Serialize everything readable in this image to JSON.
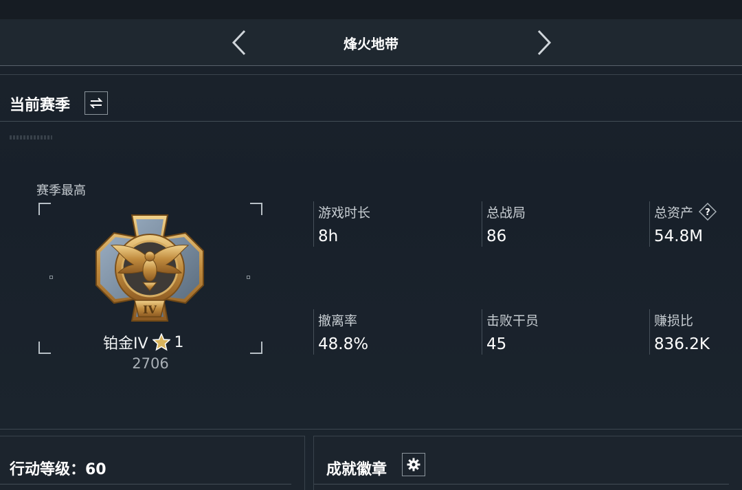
{
  "header": {
    "title": "烽火地带"
  },
  "season": {
    "title": "当前赛季",
    "rank_label": "赛季最高",
    "rank_name": "铂金IV",
    "rank_stars": "1",
    "rank_score": "2706",
    "medal_numeral": "IV"
  },
  "stats": [
    {
      "label": "游戏时长",
      "value": "8h"
    },
    {
      "label": "总战局",
      "value": "86"
    },
    {
      "label": "总资产",
      "value": "54.8M"
    },
    {
      "label": "撤离率",
      "value": "48.8%"
    },
    {
      "label": "击败干员",
      "value": "45"
    },
    {
      "label": "赚损比",
      "value": "836.2K"
    }
  ],
  "panels": {
    "level_title": "行动等级：60",
    "badges_title": "成就徽章"
  },
  "icons": {
    "prev": "chevron-left-icon",
    "next": "chevron-right-icon",
    "switch": "swap-icon",
    "help": "question-icon",
    "settings": "gear-icon",
    "star": "star-icon"
  },
  "colors": {
    "background": "#1a212a",
    "gold": "#c9a25a",
    "text": "#ffffff"
  }
}
